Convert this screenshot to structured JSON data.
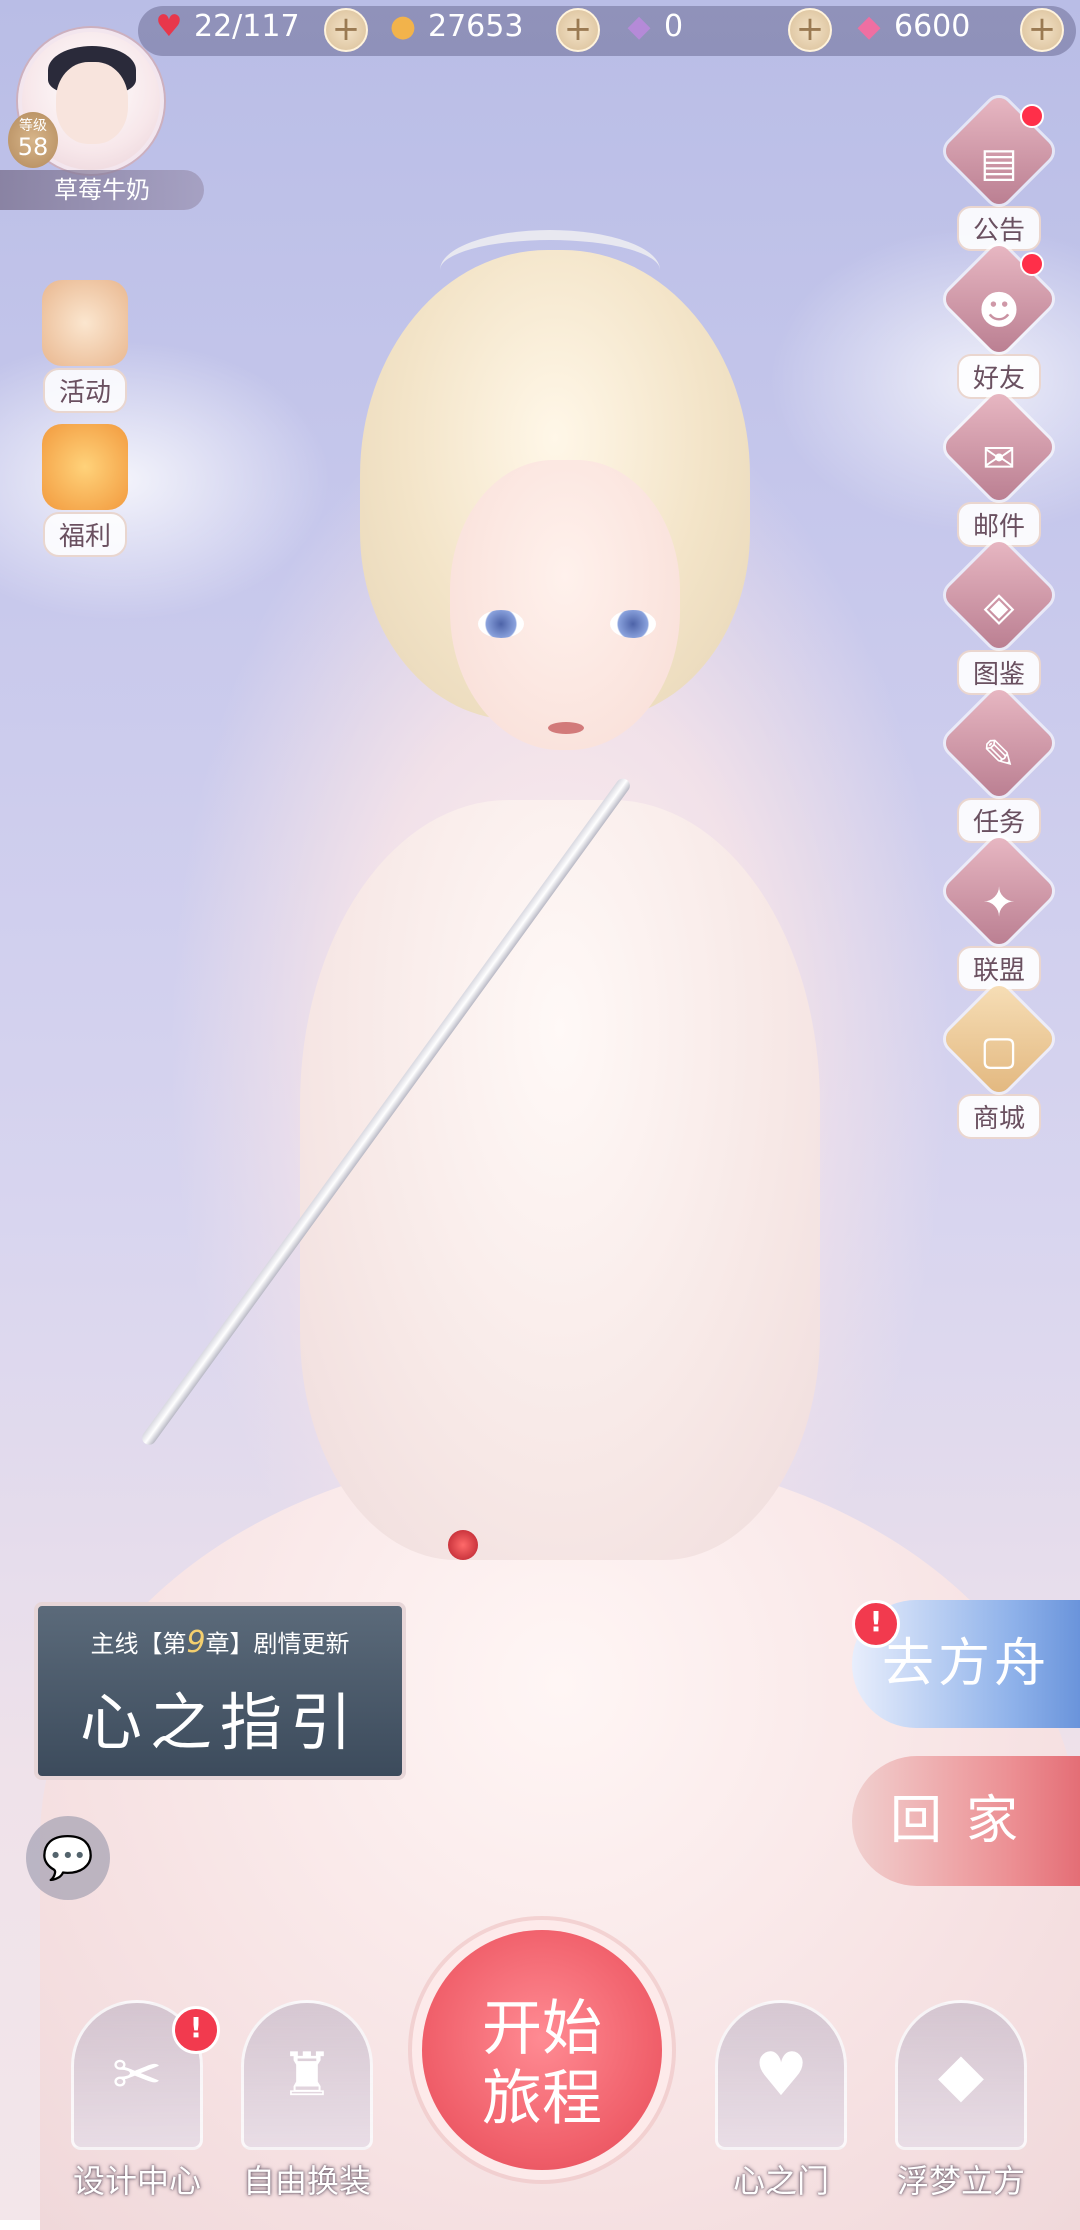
{
  "resources": {
    "stamina": "22/117",
    "coins": "27653",
    "diamonds": "0",
    "pink_diamonds": "6600",
    "plus": "+"
  },
  "player": {
    "level_label": "等级",
    "level": "58",
    "name": "草莓牛奶"
  },
  "left_events": [
    {
      "label": "活动"
    },
    {
      "label": "福利"
    }
  ],
  "right_menu": [
    {
      "label": "公告",
      "icon": "notice-board-icon",
      "glyph": "▤"
    },
    {
      "label": "好友",
      "icon": "friend-icon",
      "glyph": "☻"
    },
    {
      "label": "邮件",
      "icon": "mail-icon",
      "glyph": "✉"
    },
    {
      "label": "图鉴",
      "icon": "collection-book-icon",
      "glyph": "◈"
    },
    {
      "label": "任务",
      "icon": "quest-icon",
      "glyph": "✎"
    },
    {
      "label": "联盟",
      "icon": "alliance-icon",
      "glyph": "✦"
    },
    {
      "label": "商城",
      "icon": "shop-bag-icon",
      "glyph": "▢"
    }
  ],
  "story": {
    "prefix": "主线【第",
    "chapter": "9",
    "suffix": "章】剧情更新",
    "title": "心之指引"
  },
  "ark_button": "去方舟",
  "home_button": "回家",
  "chat_icon": "💬",
  "start": {
    "line1": "开始",
    "line2": "旅程"
  },
  "bottom_nav": [
    {
      "label": "设计中心",
      "icon": "design-center-icon",
      "glyph": "✂"
    },
    {
      "label": "自由换装",
      "icon": "wardrobe-icon",
      "glyph": "♜"
    },
    {
      "label": "心之门",
      "icon": "heart-gate-icon",
      "glyph": "♥"
    },
    {
      "label": "浮梦立方",
      "icon": "dream-cube-icon",
      "glyph": "◆"
    }
  ],
  "colors": {
    "accent": "#f05f6a",
    "badge_red": "#f23a4e",
    "ark_blue": "#8fb2ea"
  }
}
